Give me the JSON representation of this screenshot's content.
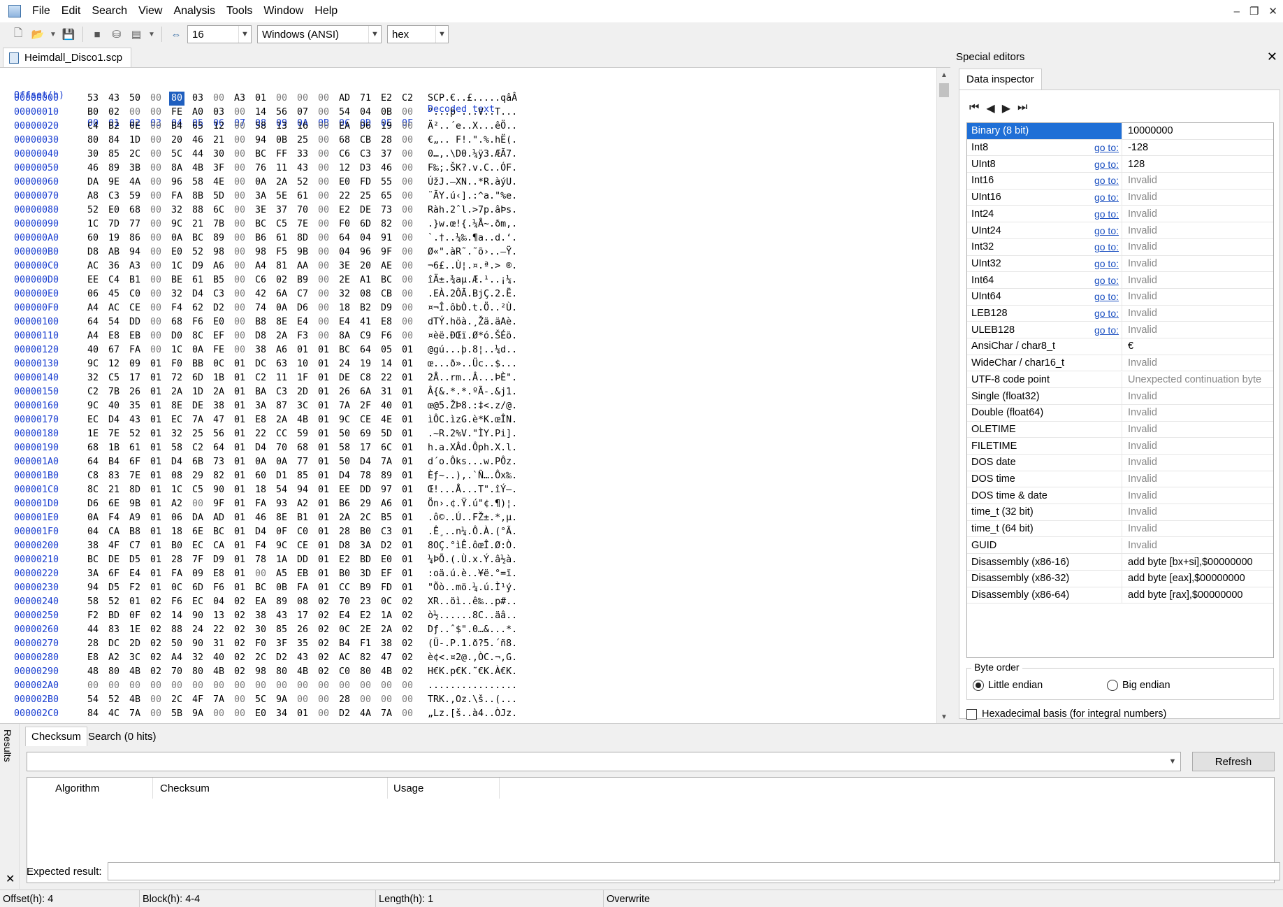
{
  "menu": [
    "File",
    "Edit",
    "Search",
    "View",
    "Analysis",
    "Tools",
    "Window",
    "Help"
  ],
  "toolbar": {
    "bytes_per_row": "16",
    "encoding": "Windows (ANSI)",
    "display_mode": "hex"
  },
  "document_tab": "Heimdall_Disco1.scp",
  "hex": {
    "offset_header": "Offset(h)",
    "column_headers": [
      "00",
      "01",
      "02",
      "03",
      "04",
      "05",
      "06",
      "07",
      "08",
      "09",
      "0A",
      "0B",
      "0C",
      "0D",
      "0E",
      "0F"
    ],
    "decoded_header": "Decoded text",
    "selected_row": 0,
    "selected_col": 4,
    "rows": [
      {
        "offset": "00000000",
        "bytes": "53 43 50 00 80 03 00 A3 01 00 00 00 AD 71 E2 C2",
        "text": "SCP.€..£.....qâÂ"
      },
      {
        "offset": "00000010",
        "bytes": "B0 02 00 00 FE A0 03 00 14 56 07 00 54 04 0B 00",
        "text": "°...þ ...V..T..."
      },
      {
        "offset": "00000020",
        "bytes": "C4 B2 0E 00 B4 65 12 00 58 13 16 00 EA D6 19 00",
        "text": "Ä²..´e..X...êÖ.."
      },
      {
        "offset": "00000030",
        "bytes": "80 84 1D 00 20 46 21 00 94 0B 25 00 68 CB 28 00",
        "text": "€„.. F!.\".%.hË(."
      },
      {
        "offset": "00000040",
        "bytes": "30 85 2C 00 5C 44 30 00 BC FF 33 00 C6 C3 37 00",
        "text": "0…,.\\D0.¼ÿ3.ÆÃ7."
      },
      {
        "offset": "00000050",
        "bytes": "46 89 3B 00 8A 4B 3F 00 76 11 43 00 12 D3 46 00",
        "text": "F‰;.ŠK?.v.C..ÓF."
      },
      {
        "offset": "00000060",
        "bytes": "DA 9E 4A 00 96 58 4E 00 0A 2A 52 00 E0 FD 55 00",
        "text": "ÚžJ.–XN..*R.àýU."
      },
      {
        "offset": "00000070",
        "bytes": "A8 C3 59 00 FA 8B 5D 00 3A 5E 61 00 22 25 65 00",
        "text": "¨ÃY.ú‹].:^a.\"%e."
      },
      {
        "offset": "00000080",
        "bytes": "52 E0 68 00 32 88 6C 00 3E 37 70 00 E2 DE 73 00",
        "text": "Ràh.2ˆl.>7p.âÞs."
      },
      {
        "offset": "00000090",
        "bytes": "1C 7D 77 00 9C 21 7B 00 BC C5 7E 00 F0 6D 82 00",
        "text": ".}w.œ!{.¼Å~.ðm‚."
      },
      {
        "offset": "000000A0",
        "bytes": "60 19 86 00 0A BC 89 00 B6 61 8D 00 64 04 91 00",
        "text": "`.†..¼‰.¶a..d.‘."
      },
      {
        "offset": "000000B0",
        "bytes": "D8 AB 94 00 E0 52 98 00 98 F5 9B 00 04 96 9F 00",
        "text": "Ø«\".àR˜.˜õ›..–Ÿ."
      },
      {
        "offset": "000000C0",
        "bytes": "AC 36 A3 00 1C D9 A6 00 A4 81 AA 00 3E 20 AE 00",
        "text": "¬6£..Ù¦.¤.ª.> ®."
      },
      {
        "offset": "000000D0",
        "bytes": "EE C4 B1 00 BE 61 B5 00 C6 02 B9 00 2E A1 BC 00",
        "text": "îÄ±.¾aµ.Æ.¹..¡¼."
      },
      {
        "offset": "000000E0",
        "bytes": "06 45 C0 00 32 D4 C3 00 42 6A C7 00 32 08 CB 00",
        "text": ".EÀ.2ÔÃ.BjÇ.2.Ë."
      },
      {
        "offset": "000000F0",
        "bytes": "A4 AC CE 00 F4 62 D2 00 74 0A D6 00 18 B2 D9 00",
        "text": "¤¬Î.ôbÒ.t.Ö..²Ù."
      },
      {
        "offset": "00000100",
        "bytes": "64 54 DD 00 68 F6 E0 00 B8 8E E4 00 E4 41 E8 00",
        "text": "dTÝ.höà.¸Žä.äAè."
      },
      {
        "offset": "00000110",
        "bytes": "A4 E8 EB 00 D0 8C EF 00 D8 2A F3 00 8A C9 F6 00",
        "text": "¤èë.ÐŒï.Ø*ó.ŠÉö."
      },
      {
        "offset": "00000120",
        "bytes": "40 67 FA 00 1C 0A FE 00 38 A6 01 01 BC 64 05 01",
        "text": "@gú...þ.8¦..¼d.."
      },
      {
        "offset": "00000130",
        "bytes": "9C 12 09 01 F0 BB 0C 01 DC 63 10 01 24 19 14 01",
        "text": "œ...ð»..Üc..$..."
      },
      {
        "offset": "00000140",
        "bytes": "32 C5 17 01 72 6D 1B 01 C2 11 1F 01 DE C8 22 01",
        "text": "2Å..rm..Â...ÞÈ\"."
      },
      {
        "offset": "00000150",
        "bytes": "C2 7B 26 01 2A 1D 2A 01 BA C3 2D 01 26 6A 31 01",
        "text": "Â{&.*.*.ºÃ-.&j1."
      },
      {
        "offset": "00000160",
        "bytes": "9C 40 35 01 8E DE 38 01 3A 87 3C 01 7A 2F 40 01",
        "text": "œ@5.ŽÞ8.:‡<.z/@."
      },
      {
        "offset": "00000170",
        "bytes": "EC D4 43 01 EC 7A 47 01 E8 2A 4B 01 9C CE 4E 01",
        "text": "ìÔC.ìzG.è*K.œÎN."
      },
      {
        "offset": "00000180",
        "bytes": "1E 7E 52 01 32 25 56 01 22 CC 59 01 50 69 5D 01",
        "text": ".~R.2%V.\"ÌY.Pi]."
      },
      {
        "offset": "00000190",
        "bytes": "68 1B 61 01 58 C2 64 01 D4 70 68 01 58 17 6C 01",
        "text": "h.a.XÂd.Ôph.X.l."
      },
      {
        "offset": "000001A0",
        "bytes": "64 B4 6F 01 D4 6B 73 01 0A 0A 77 01 50 D4 7A 01",
        "text": "d´o.Ôks...w.PÔz."
      },
      {
        "offset": "000001B0",
        "bytes": "C8 83 7E 01 08 29 82 01 60 D1 85 01 D4 78 89 01",
        "text": "Èƒ~..)‚.`Ñ….Ôx‰."
      },
      {
        "offset": "000001C0",
        "bytes": "8C 21 8D 01 1C C5 90 01 18 54 94 01 EE DD 97 01",
        "text": "Œ!...Å...T\".îÝ—."
      },
      {
        "offset": "000001D0",
        "bytes": "D6 6E 9B 01 A2 00 9F 01 FA 93 A2 01 B6 29 A6 01",
        "text": "Ön›.¢.Ÿ.ú\"¢.¶)¦."
      },
      {
        "offset": "000001E0",
        "bytes": "0A F4 A9 01 06 DA AD 01 46 8E B1 01 2A 2C B5 01",
        "text": ".ô©..Ú..FŽ±.*,µ."
      },
      {
        "offset": "000001F0",
        "bytes": "04 CA B8 01 18 6E BC 01 D4 0F C0 01 28 B0 C3 01",
        "text": ".Ê¸..n¼.Ô.À.(°Ã."
      },
      {
        "offset": "00000200",
        "bytes": "38 4F C7 01 B0 EC CA 01 F4 9C CE 01 D8 3A D2 01",
        "text": "8OÇ.°ìÊ.ôœÎ.Ø:Ò."
      },
      {
        "offset": "00000210",
        "bytes": "BC DE D5 01 28 7F D9 01 78 1A DD 01 E2 BD E0 01",
        "text": "¼ÞÕ.(.Ù.x.Ý.â½à."
      },
      {
        "offset": "00000220",
        "bytes": "3A 6F E4 01 FA 09 E8 01 00 A5 EB 01 B0 3D EF 01",
        "text": ":oä.ú.è..¥ë.°=ï."
      },
      {
        "offset": "00000230",
        "bytes": "94 D5 F2 01 0C 6D F6 01 BC 0B FA 01 CC B9 FD 01",
        "text": "\"Õò..mö.¼.ú.Ì¹ý."
      },
      {
        "offset": "00000240",
        "bytes": "58 52 01 02 F6 EC 04 02 EA 89 08 02 70 23 0C 02",
        "text": "XR..öì..ê‰..p#.."
      },
      {
        "offset": "00000250",
        "bytes": "F2 BD 0F 02 14 90 13 02 38 43 17 02 E4 E2 1A 02",
        "text": "ò½......8C..äâ.."
      },
      {
        "offset": "00000260",
        "bytes": "44 83 1E 02 88 24 22 02 30 85 26 02 0C 2E 2A 02",
        "text": "Dƒ..ˆ$\".0…&...*."
      },
      {
        "offset": "00000270",
        "bytes": "28 DC 2D 02 50 90 31 02 F0 3F 35 02 B4 F1 38 02",
        "text": "(Ü-.P.1.ð?5.´ñ8."
      },
      {
        "offset": "00000280",
        "bytes": "E8 A2 3C 02 A4 32 40 02 2C D2 43 02 AC 82 47 02",
        "text": "è¢<.¤2@.,ÒC.¬‚G."
      },
      {
        "offset": "00000290",
        "bytes": "48 80 4B 02 70 80 4B 02 98 80 4B 02 C0 80 4B 02",
        "text": "H€K.p€K.˜€K.À€K."
      },
      {
        "offset": "000002A0",
        "bytes": "00 00 00 00 00 00 00 00 00 00 00 00 00 00 00 00",
        "text": "................"
      },
      {
        "offset": "000002B0",
        "bytes": "54 52 4B 00 2C 4F 7A 00 5C 9A 00 00 28 00 00 00",
        "text": "TRK.,Oz.\\š..(..."
      },
      {
        "offset": "000002C0",
        "bytes": "84 4C 7A 00 5B 9A 00 00 E0 34 01 00 D2 4A 7A 00",
        "text": "„Lz.[š..à4..ÒJz."
      }
    ]
  },
  "special_editors": {
    "title": "Special editors",
    "tab": "Data inspector",
    "goto_label": "go to:",
    "rows": [
      {
        "name": "Binary (8 bit)",
        "goto": false,
        "value": "10000000",
        "invalid": false,
        "selected": true
      },
      {
        "name": "Int8",
        "goto": true,
        "value": "-128",
        "invalid": false
      },
      {
        "name": "UInt8",
        "goto": true,
        "value": "128",
        "invalid": false
      },
      {
        "name": "Int16",
        "goto": true,
        "value": "Invalid",
        "invalid": true
      },
      {
        "name": "UInt16",
        "goto": true,
        "value": "Invalid",
        "invalid": true
      },
      {
        "name": "Int24",
        "goto": true,
        "value": "Invalid",
        "invalid": true
      },
      {
        "name": "UInt24",
        "goto": true,
        "value": "Invalid",
        "invalid": true
      },
      {
        "name": "Int32",
        "goto": true,
        "value": "Invalid",
        "invalid": true
      },
      {
        "name": "UInt32",
        "goto": true,
        "value": "Invalid",
        "invalid": true
      },
      {
        "name": "Int64",
        "goto": true,
        "value": "Invalid",
        "invalid": true
      },
      {
        "name": "UInt64",
        "goto": true,
        "value": "Invalid",
        "invalid": true
      },
      {
        "name": "LEB128",
        "goto": true,
        "value": "Invalid",
        "invalid": true
      },
      {
        "name": "ULEB128",
        "goto": true,
        "value": "Invalid",
        "invalid": true
      },
      {
        "name": "AnsiChar / char8_t",
        "goto": false,
        "value": "€",
        "invalid": false
      },
      {
        "name": "WideChar / char16_t",
        "goto": false,
        "value": "Invalid",
        "invalid": true
      },
      {
        "name": "UTF-8 code point",
        "goto": false,
        "value": "Unexpected continuation byte",
        "invalid": true
      },
      {
        "name": "Single (float32)",
        "goto": false,
        "value": "Invalid",
        "invalid": true
      },
      {
        "name": "Double (float64)",
        "goto": false,
        "value": "Invalid",
        "invalid": true
      },
      {
        "name": "OLETIME",
        "goto": false,
        "value": "Invalid",
        "invalid": true
      },
      {
        "name": "FILETIME",
        "goto": false,
        "value": "Invalid",
        "invalid": true
      },
      {
        "name": "DOS date",
        "goto": false,
        "value": "Invalid",
        "invalid": true
      },
      {
        "name": "DOS time",
        "goto": false,
        "value": "Invalid",
        "invalid": true
      },
      {
        "name": "DOS time & date",
        "goto": false,
        "value": "Invalid",
        "invalid": true
      },
      {
        "name": "time_t (32 bit)",
        "goto": false,
        "value": "Invalid",
        "invalid": true
      },
      {
        "name": "time_t (64 bit)",
        "goto": false,
        "value": "Invalid",
        "invalid": true
      },
      {
        "name": "GUID",
        "goto": false,
        "value": "Invalid",
        "invalid": true
      },
      {
        "name": "Disassembly (x86-16)",
        "goto": false,
        "value": "add byte [bx+si],$00000000",
        "invalid": false
      },
      {
        "name": "Disassembly (x86-32)",
        "goto": false,
        "value": "add byte [eax],$00000000",
        "invalid": false
      },
      {
        "name": "Disassembly (x86-64)",
        "goto": false,
        "value": "add byte [rax],$00000000",
        "invalid": false
      }
    ],
    "byte_order_label": "Byte order",
    "little_endian": "Little endian",
    "big_endian": "Big endian",
    "hex_basis": "Hexadecimal basis (for integral numbers)"
  },
  "results": {
    "side_label": "Results",
    "tabs": [
      "Checksum",
      "Search (0 hits)"
    ],
    "refresh_label": "Refresh",
    "columns": [
      "Algorithm",
      "Checksum",
      "Usage"
    ],
    "expected_label": "Expected result:"
  },
  "status": {
    "offset": "Offset(h): 4",
    "block": "Block(h): 4-4",
    "length": "Length(h): 1",
    "mode": "Overwrite"
  }
}
